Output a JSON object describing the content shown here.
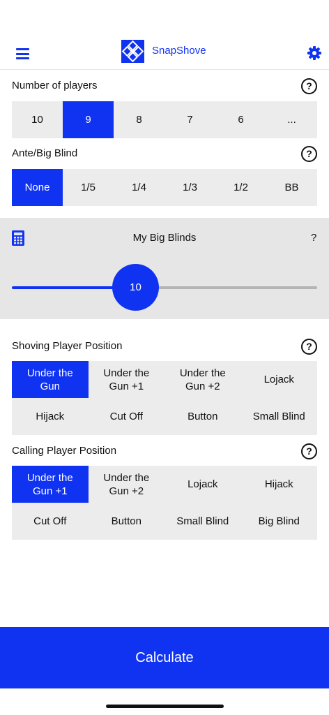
{
  "header": {
    "app_title": "SnapShove",
    "menu_icon": "hamburger-menu-icon",
    "settings_icon": "gear-icon",
    "brand_color": "#1033f2"
  },
  "players": {
    "label": "Number of players",
    "help": "?",
    "options": [
      "10",
      "9",
      "8",
      "7",
      "6",
      "..."
    ],
    "selected": "9"
  },
  "ante": {
    "label": "Ante/Big Blind",
    "help": "?",
    "options": [
      "None",
      "1/5",
      "1/4",
      "1/3",
      "1/2",
      "BB"
    ],
    "selected": "None"
  },
  "slider": {
    "title": "My Big Blinds",
    "help": "?",
    "value": "10",
    "icon": "calculator-icon"
  },
  "shoving": {
    "label": "Shoving Player Position",
    "help": "?",
    "options": [
      "Under the Gun",
      "Under the Gun +1",
      "Under the Gun +2",
      "Lojack",
      "Hijack",
      "Cut Off",
      "Button",
      "Small Blind"
    ],
    "selected": "Under the Gun"
  },
  "calling": {
    "label": "Calling Player Position",
    "help": "?",
    "options": [
      "Under the Gun +1",
      "Under the Gun +2",
      "Lojack",
      "Hijack",
      "Cut Off",
      "Button",
      "Small Blind",
      "Big Blind"
    ],
    "selected": "Under the Gun +1"
  },
  "calculate_label": "Calculate"
}
